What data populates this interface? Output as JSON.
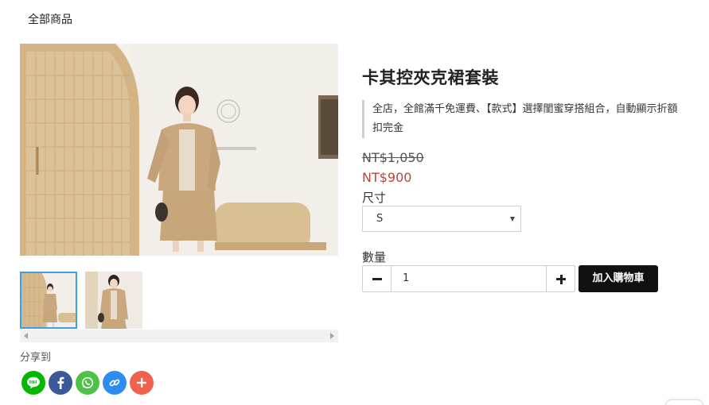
{
  "breadcrumb": {
    "label": "全部商品"
  },
  "product": {
    "title": "卡其控夾克裙套裝",
    "promo": "全店，全館滿千免運費、【款式】選擇閨蜜穿搭組合，自動顯示折額扣完金",
    "price_original": "NT$1,050",
    "price_sale": "NT$900",
    "sale_color": "#b8463a"
  },
  "options": {
    "size_label": "尺寸",
    "size_selected": "S",
    "quantity_label": "數量",
    "quantity_value": "1",
    "add_to_cart": "加入購物車"
  },
  "gallery": {
    "thumbnail_count": 2,
    "active_index": 0,
    "active_color": "#3d9ee0"
  },
  "share": {
    "label": "分享到",
    "buttons": [
      {
        "icon": "line-icon",
        "color": "#00b900"
      },
      {
        "icon": "facebook-icon",
        "color": "#3b5998"
      },
      {
        "icon": "whatsapp-icon",
        "color": "#4dc247"
      },
      {
        "icon": "link-icon",
        "color": "#2d8cf0"
      },
      {
        "icon": "plus-icon",
        "color": "#f0624e"
      }
    ]
  }
}
